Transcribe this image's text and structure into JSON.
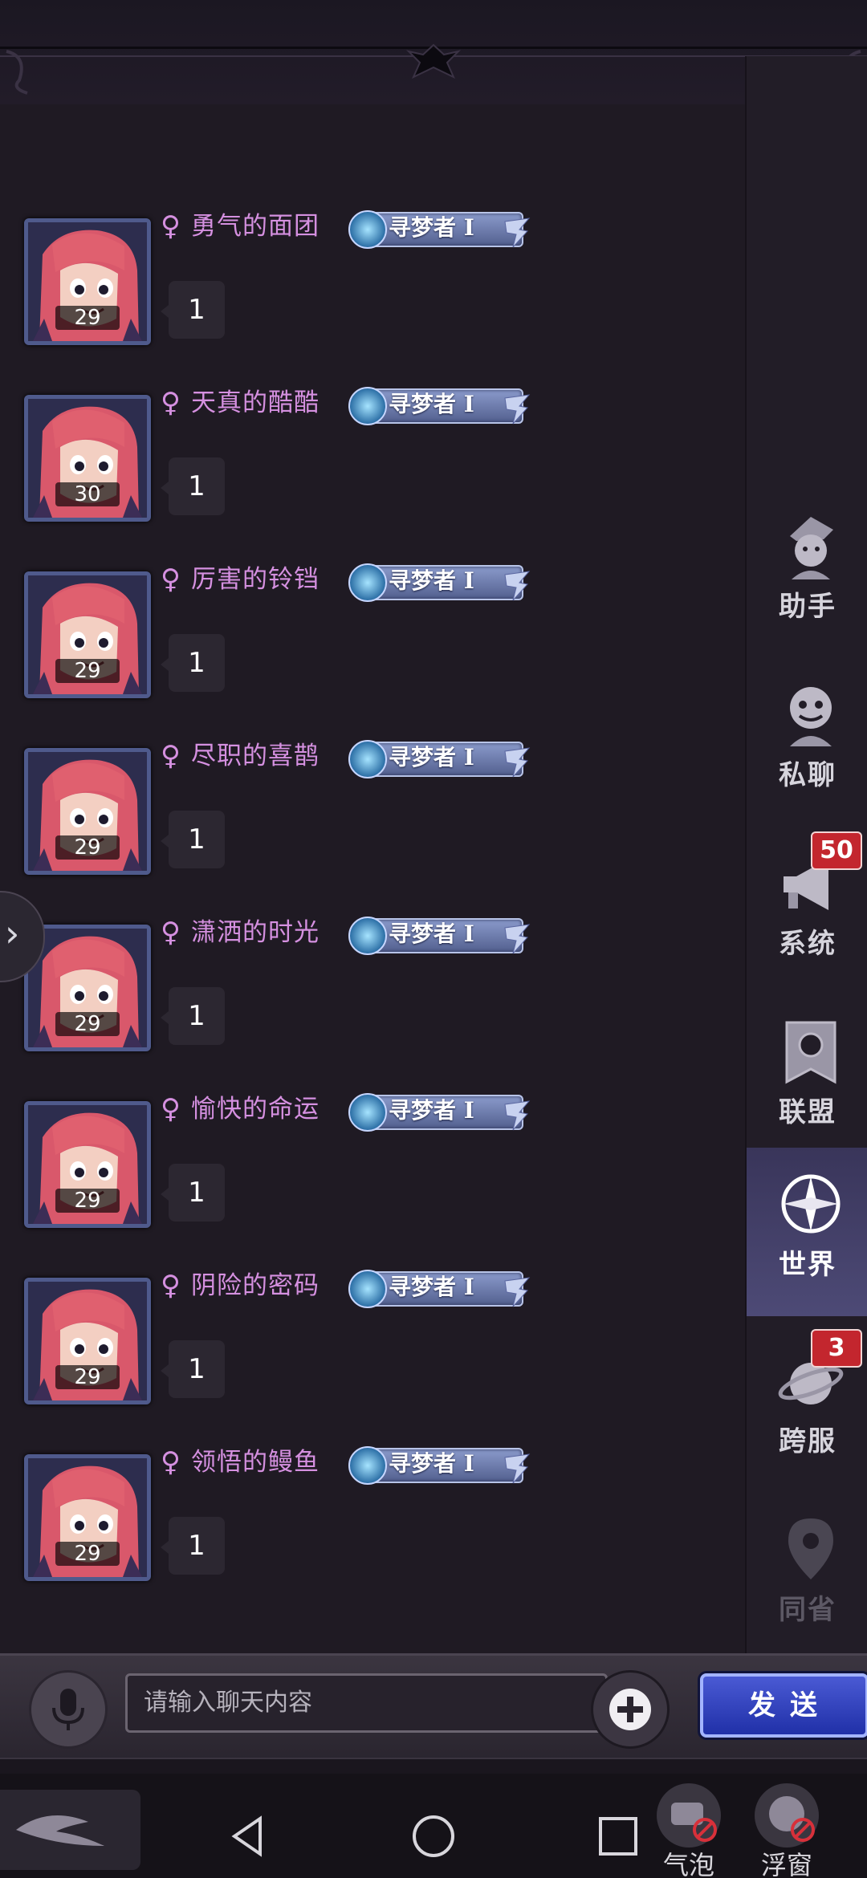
{
  "colors": {
    "name": "#d590e0",
    "accent": "#4a5ad4",
    "notification": "#c3262e",
    "badge": "#6b7ab0"
  },
  "messages": [
    {
      "gender_icon": "♀",
      "name": "勇气的面团",
      "level": "29",
      "title": "寻梦者 I",
      "text": "1"
    },
    {
      "gender_icon": "♀",
      "name": "天真的酷酷",
      "level": "30",
      "title": "寻梦者 I",
      "text": "1"
    },
    {
      "gender_icon": "♀",
      "name": "厉害的铃铛",
      "level": "29",
      "title": "寻梦者 I",
      "text": "1"
    },
    {
      "gender_icon": "♀",
      "name": "尽职的喜鹊",
      "level": "29",
      "title": "寻梦者 I",
      "text": "1"
    },
    {
      "gender_icon": "♀",
      "name": "潇洒的时光",
      "level": "29",
      "title": "寻梦者 I",
      "text": "1"
    },
    {
      "gender_icon": "♀",
      "name": "愉快的命运",
      "level": "29",
      "title": "寻梦者 I",
      "text": "1"
    },
    {
      "gender_icon": "♀",
      "name": "阴险的密码",
      "level": "29",
      "title": "寻梦者 I",
      "text": "1"
    },
    {
      "gender_icon": "♀",
      "name": "领悟的鳗鱼",
      "level": "29",
      "title": "寻梦者 I",
      "text": "1"
    }
  ],
  "sidebar": {
    "items": [
      {
        "label": "助手",
        "icon": "assistant-icon"
      },
      {
        "label": "私聊",
        "icon": "private-chat-icon"
      },
      {
        "label": "系统",
        "icon": "megaphone-icon",
        "badge": "50"
      },
      {
        "label": "联盟",
        "icon": "banner-icon"
      },
      {
        "label": "世界",
        "icon": "compass-icon",
        "active": true
      },
      {
        "label": "跨服",
        "icon": "planet-icon",
        "badge": "3"
      },
      {
        "label": "同省",
        "icon": "location-pin-icon",
        "disabled": true
      }
    ]
  },
  "input": {
    "placeholder": "请输入聊天内容",
    "send_label": "发送"
  },
  "nav": {
    "bubble_label": "气泡",
    "float_window_label": "浮窗"
  }
}
